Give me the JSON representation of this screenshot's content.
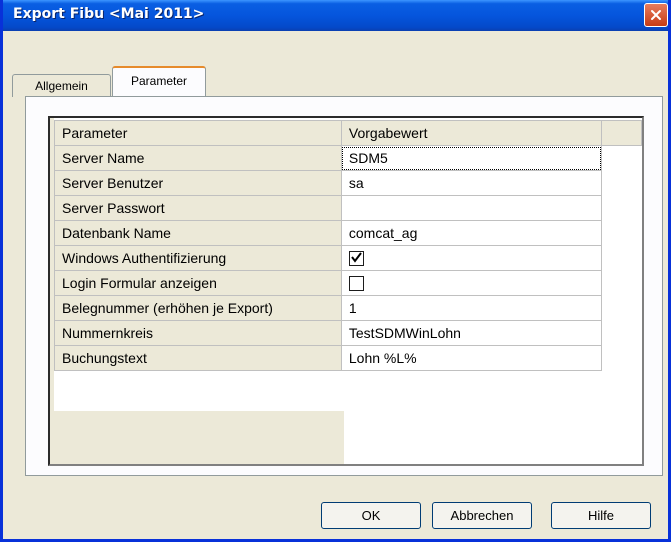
{
  "window": {
    "title": "Export Fibu <Mai 2011>"
  },
  "tabs": [
    {
      "label": "Allgemein"
    },
    {
      "label": "Parameter"
    }
  ],
  "grid": {
    "headers": [
      "Parameter",
      "Vorgabewert"
    ],
    "rows": [
      {
        "name": "Server Name",
        "value": "SDM5"
      },
      {
        "name": "Server Benutzer",
        "value": "sa"
      },
      {
        "name": "Server Passwort",
        "value": ""
      },
      {
        "name": "Datenbank Name",
        "value": "comcat_ag"
      },
      {
        "name": "Windows Authentifizierung",
        "value": "",
        "checked": true
      },
      {
        "name": "Login Formular anzeigen",
        "value": "",
        "checked": false
      },
      {
        "name": "Belegnummer (erhöhen je Export)",
        "value": "1"
      },
      {
        "name": "Nummernkreis",
        "value": "TestSDMWinLohn"
      },
      {
        "name": "Buchungstext",
        "value": "Lohn %L%"
      }
    ]
  },
  "buttons": {
    "ok": "OK",
    "cancel": "Abbrechen",
    "help": "Hilfe"
  },
  "colors": {
    "titlebar": "#0555dd",
    "accent": "#e68b2c",
    "close": "#c73b13"
  }
}
